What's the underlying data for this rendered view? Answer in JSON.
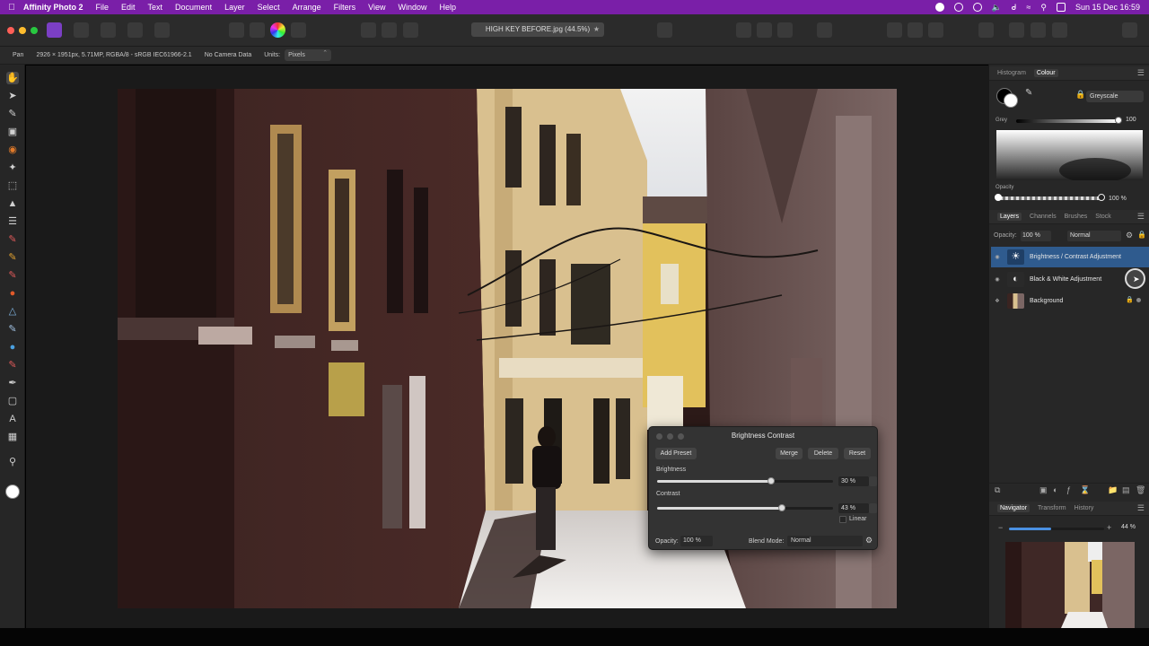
{
  "menubar": {
    "app_name": "Affinity Photo 2",
    "items": [
      "File",
      "Edit",
      "Text",
      "Document",
      "Layer",
      "Select",
      "Arrange",
      "Filters",
      "View",
      "Window",
      "Help"
    ],
    "clock": "Sun 15 Dec  16:59"
  },
  "toolbar": {
    "document_tab": "HIGH KEY BEFORE.jpg (44.5%)"
  },
  "contextbar": {
    "tool": "Pan",
    "doc_info": "2926 × 1951px, 5.71MP, RGBA/8 - sRGB IEC61966-2.1",
    "camera": "No Camera Data",
    "units_label": "Units:",
    "units_value": "Pixels"
  },
  "colour_panel": {
    "tabs": [
      "Histogram",
      "Colour"
    ],
    "active_tab": "Colour",
    "mode": "Greyscale",
    "grey_label": "Grey",
    "grey_value": "100",
    "opacity_label": "Opacity",
    "opacity_value": "100 %"
  },
  "layers_panel": {
    "tabs": [
      "Layers",
      "Channels",
      "Brushes",
      "Stock"
    ],
    "active_tab": "Layers",
    "opacity_label": "Opacity:",
    "opacity_value": "100 %",
    "blend_mode": "Normal",
    "layers": [
      {
        "name": "Brightness / Contrast Adjustment",
        "selected": true
      },
      {
        "name": "Black & White Adjustment",
        "selected": false
      },
      {
        "name": "Background",
        "selected": false
      }
    ]
  },
  "navigator_panel": {
    "tabs": [
      "Navigator",
      "Transform",
      "History"
    ],
    "active_tab": "Navigator",
    "zoom": "44 %",
    "zoom_fraction": 0.44
  },
  "dialog": {
    "title": "Brightness Contrast",
    "add_preset": "Add Preset",
    "merge": "Merge",
    "delete": "Delete",
    "reset": "Reset",
    "brightness_label": "Brightness",
    "brightness_value": "30 %",
    "brightness_fraction": 0.65,
    "contrast_label": "Contrast",
    "contrast_value": "43 %",
    "contrast_fraction": 0.71,
    "linear_label": "Linear",
    "opacity_label": "Opacity:",
    "opacity_value": "100 %",
    "blend_label": "Blend Mode:",
    "blend_value": "Normal"
  },
  "colors": {
    "menubar": "#7a1fa8",
    "selection": "#2f5b8e",
    "panel": "#272727"
  }
}
